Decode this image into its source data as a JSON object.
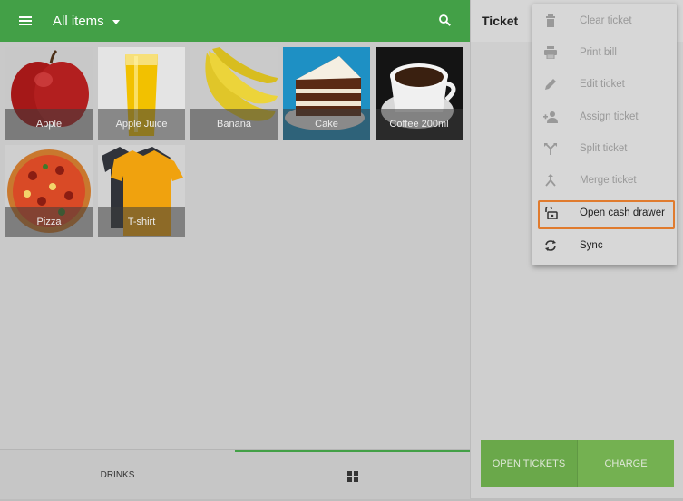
{
  "header": {
    "title": "All items"
  },
  "items": [
    {
      "name": "Apple",
      "image": "apple"
    },
    {
      "name": "Apple Juice",
      "image": "juice-glass"
    },
    {
      "name": "Banana",
      "image": "bananas"
    },
    {
      "name": "Cake",
      "image": "cake-slice"
    },
    {
      "name": "Coffee 200ml",
      "image": "coffee-cup"
    },
    {
      "name": "Pizza",
      "image": "pizza"
    },
    {
      "name": "T-shirt",
      "image": "tshirts"
    }
  ],
  "bottom_tabs": {
    "drinks_label": "DRINKS"
  },
  "ticket": {
    "title": "Ticket",
    "open_tickets_label": "OPEN TICKETS",
    "charge_label": "CHARGE"
  },
  "menu": {
    "items": [
      {
        "label": "Clear ticket",
        "icon": "trash-icon",
        "enabled": false
      },
      {
        "label": "Print bill",
        "icon": "printer-icon",
        "enabled": false
      },
      {
        "label": "Edit ticket",
        "icon": "pencil-icon",
        "enabled": false
      },
      {
        "label": "Assign ticket",
        "icon": "assign-user-icon",
        "enabled": false
      },
      {
        "label": "Split ticket",
        "icon": "split-icon",
        "enabled": false
      },
      {
        "label": "Merge ticket",
        "icon": "merge-icon",
        "enabled": false
      },
      {
        "label": "Open cash drawer",
        "icon": "unlock-icon",
        "enabled": true
      },
      {
        "label": "Sync",
        "icon": "sync-icon",
        "enabled": true
      }
    ],
    "highlight_color": "#e07b2e"
  },
  "colors": {
    "accent": "#43a047"
  }
}
